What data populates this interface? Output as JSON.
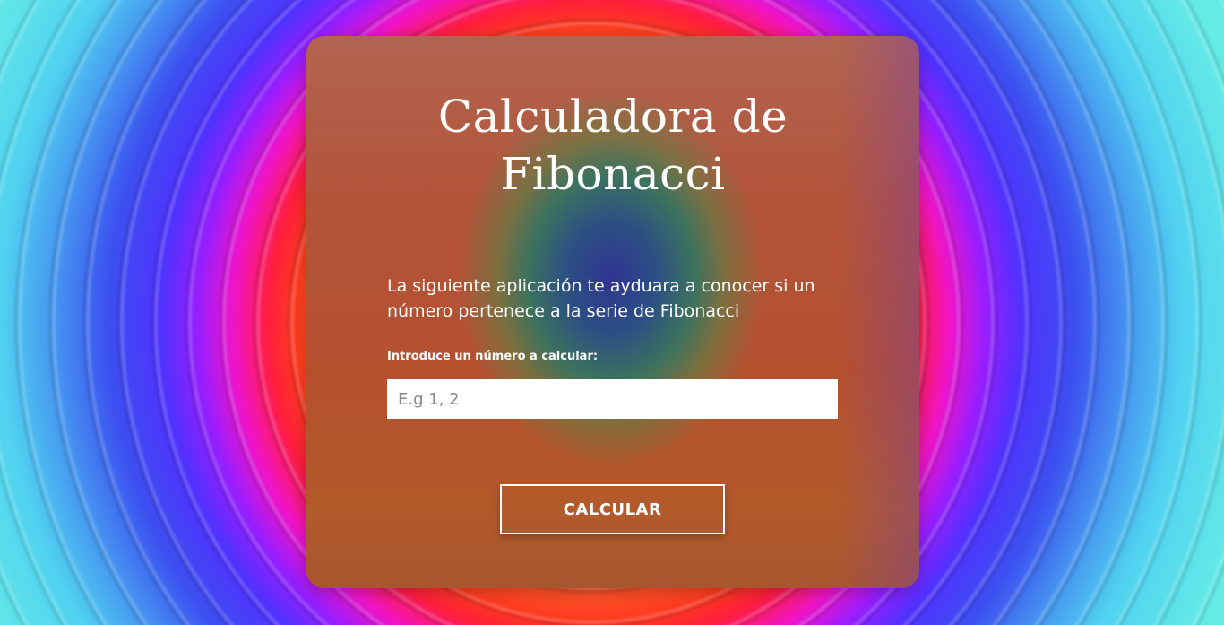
{
  "app": {
    "title_line1": "Calculadora de",
    "title_line2": "Fibonacci",
    "description": "La siguiente aplicación te ayduara a conocer si un número pertenece a la serie de Fibonacci",
    "input_label": "Introduce un número a calcular:",
    "input_placeholder": "E.g 1, 2",
    "input_value": "",
    "button_label": "CALCULAR"
  },
  "colors": {
    "text": "#ffffff",
    "input_bg": "#ffffff",
    "button_border": "#ffffff"
  }
}
